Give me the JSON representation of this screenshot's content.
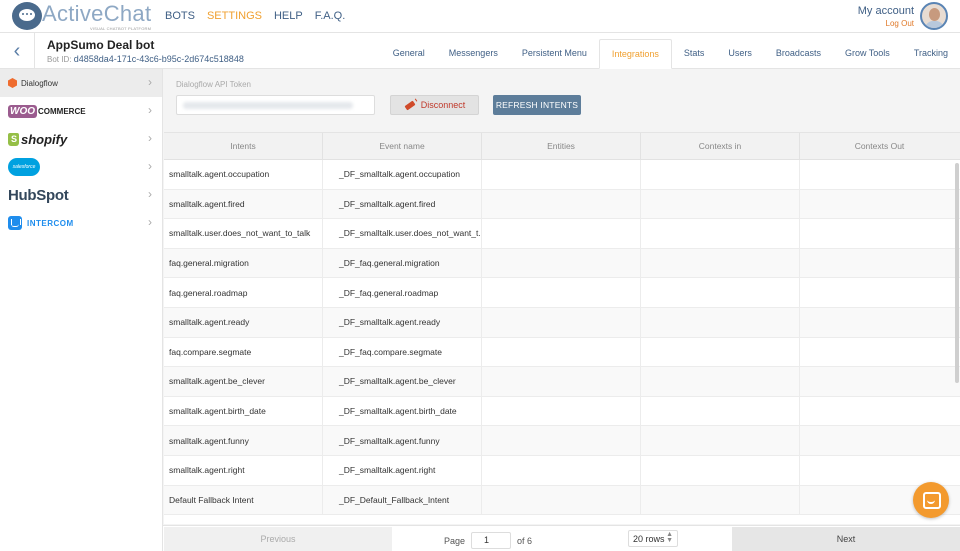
{
  "app": {
    "logo_text": "ActiveChat",
    "tagline": "VISUAL CHATBOT PLATFORM",
    "nav": [
      "BOTS",
      "SETTINGS",
      "HELP",
      "F.A.Q."
    ],
    "active_nav": "SETTINGS",
    "account_label": "My account",
    "logout_label": "Log Out"
  },
  "bot": {
    "name": "AppSumo Deal bot",
    "id_label": "Bot ID:",
    "id_value": "d4858da4-171c-43c6-b95c-2d674c518848"
  },
  "tabs": [
    "General",
    "Messengers",
    "Persistent Menu",
    "Integrations",
    "Stats",
    "Users",
    "Broadcasts",
    "Grow Tools",
    "Tracking"
  ],
  "active_tab": "Integrations",
  "sidebar": {
    "items": [
      {
        "label": "Dialogflow",
        "icon": "dialogflow-logo"
      },
      {
        "label": "WOO",
        "label2": "COMMERCE",
        "icon": "woocommerce-logo"
      },
      {
        "label": "shopify",
        "icon": "shopify-logo"
      },
      {
        "label": "salesforce",
        "icon": "salesforce-logo"
      },
      {
        "label": "HubSpot",
        "icon": "hubspot-logo"
      },
      {
        "label": "INTERCOM",
        "icon": "intercom-logo"
      }
    ]
  },
  "integration": {
    "token_label": "Dialogflow API Token",
    "disconnect_label": "Disconnect",
    "refresh_label": "REFRESH INTENTS"
  },
  "table": {
    "columns": [
      "Intents",
      "Event name",
      "Entities",
      "Contexts in",
      "Contexts Out"
    ],
    "rows": [
      [
        "smalltalk.agent.occupation",
        "_DF_smalltalk.agent.occupation",
        "",
        "",
        ""
      ],
      [
        "smalltalk.agent.fired",
        "_DF_smalltalk.agent.fired",
        "",
        "",
        ""
      ],
      [
        "smalltalk.user.does_not_want_to_talk",
        "_DF_smalltalk.user.does_not_want_t...",
        "",
        "",
        ""
      ],
      [
        "faq.general.migration",
        "_DF_faq.general.migration",
        "",
        "",
        ""
      ],
      [
        "faq.general.roadmap",
        "_DF_faq.general.roadmap",
        "",
        "",
        ""
      ],
      [
        "smalltalk.agent.ready",
        "_DF_smalltalk.agent.ready",
        "",
        "",
        ""
      ],
      [
        "faq.compare.segmate",
        "_DF_faq.compare.segmate",
        "",
        "",
        ""
      ],
      [
        "smalltalk.agent.be_clever",
        "_DF_smalltalk.agent.be_clever",
        "",
        "",
        ""
      ],
      [
        "smalltalk.agent.birth_date",
        "_DF_smalltalk.agent.birth_date",
        "",
        "",
        ""
      ],
      [
        "smalltalk.agent.funny",
        "_DF_smalltalk.agent.funny",
        "",
        "",
        ""
      ],
      [
        "smalltalk.agent.right",
        "_DF_smalltalk.agent.right",
        "",
        "",
        ""
      ],
      [
        "Default Fallback Intent",
        "_DF_Default_Fallback_Intent",
        "",
        "",
        ""
      ]
    ]
  },
  "pager": {
    "previous_label": "Previous",
    "page_label": "Page",
    "page_value": "1",
    "of_label": "of 6",
    "rows_label": "20 rows",
    "next_label": "Next"
  },
  "colors": {
    "accent": "#f0a030",
    "link": "#3f5f85",
    "refresh_button": "#5d7d9a",
    "chat_bubble": "#f39a2e"
  }
}
